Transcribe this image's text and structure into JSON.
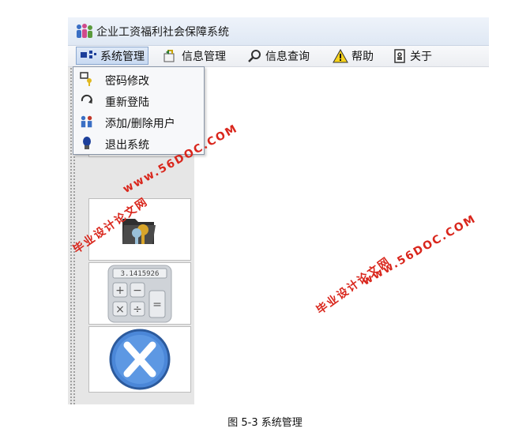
{
  "window": {
    "title": "企业工资福利社会保障系统"
  },
  "menubar": {
    "items": [
      {
        "label": "系统管理",
        "icon": "system-manage-icon"
      },
      {
        "label": "信息管理",
        "icon": "info-manage-icon"
      },
      {
        "label": "信息查询",
        "icon": "search-icon"
      },
      {
        "label": "帮助",
        "icon": "warning-icon"
      },
      {
        "label": "关于",
        "icon": "about-icon"
      }
    ]
  },
  "dropdown": {
    "items": [
      {
        "label": "密码修改",
        "icon": "key-icon"
      },
      {
        "label": "重新登陆",
        "icon": "relogin-icon"
      },
      {
        "label": "添加/删除用户",
        "icon": "users-icon"
      },
      {
        "label": "退出系统",
        "icon": "exit-icon"
      }
    ]
  },
  "toolbar": {
    "buttons": [
      {
        "icon": "magnifier-icon"
      },
      {
        "icon": "folder-key-icon"
      },
      {
        "icon": "calculator-icon",
        "display": "3.1415926"
      },
      {
        "icon": "close-icon"
      }
    ]
  },
  "watermarks": [
    "www.56DOC.COM",
    "毕业设计论文网",
    "www.56DOC.COM",
    "毕业设计论文网"
  ],
  "caption": "图 5-3 系统管理",
  "colors": {
    "watermark": "#d9261c",
    "menu_active": "#c9daf2"
  }
}
